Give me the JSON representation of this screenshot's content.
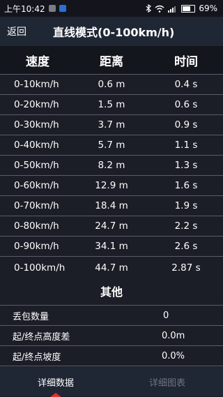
{
  "status": {
    "time": "上午10:42",
    "battery": "69%",
    "battery_level": 0.69,
    "icons": [
      "gallery-icon",
      "upload-icon",
      "bluetooth-icon",
      "wifi-icon",
      "signal-icon"
    ],
    "colors": {
      "upload_icon": "#2a6fd6",
      "gallery_icon": "#7a7d85"
    }
  },
  "app_bar": {
    "back_label": "返回",
    "title": "直线模式(0-100km/h)"
  },
  "table": {
    "headers": [
      "速度",
      "距离",
      "时间"
    ],
    "rows": [
      [
        "0-10km/h",
        "0.6 m",
        "0.4 s"
      ],
      [
        "0-20km/h",
        "1.5 m",
        "0.6 s"
      ],
      [
        "0-30km/h",
        "3.7 m",
        "0.9 s"
      ],
      [
        "0-40km/h",
        "5.7 m",
        "1.1 s"
      ],
      [
        "0-50km/h",
        "8.2 m",
        "1.3 s"
      ],
      [
        "0-60km/h",
        "12.9 m",
        "1.6 s"
      ],
      [
        "0-70km/h",
        "18.4 m",
        "1.9 s"
      ],
      [
        "0-80km/h",
        "24.7 m",
        "2.2 s"
      ],
      [
        "0-90km/h",
        "34.1 m",
        "2.6 s"
      ],
      [
        "0-100km/h",
        "44.7 m",
        "2.87 s"
      ]
    ]
  },
  "other": {
    "heading": "其他",
    "items": [
      {
        "label": "丢包数量",
        "value": "0"
      },
      {
        "label": "起/终点高度差",
        "value": "0.0m"
      },
      {
        "label": "起/终点坡度",
        "value": "0.0%"
      }
    ]
  },
  "tabs": [
    {
      "label": "详细数据",
      "active": true
    },
    {
      "label": "详细图表",
      "active": false
    }
  ],
  "colors": {
    "accent": "#e03030",
    "background": "#1c1e27",
    "app_bar": "#1f2634",
    "inactive_tab": "#6f7480"
  }
}
